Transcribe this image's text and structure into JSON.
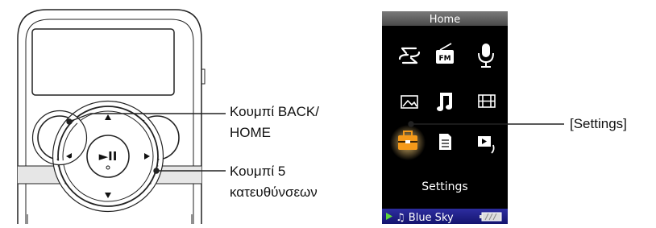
{
  "player": {
    "callouts": {
      "back_home_line1": "Κουμπί BACK/",
      "back_home_line2": "HOME",
      "five_way_line1": "Κουμπί 5",
      "five_way_line2": "κατευθύνσεων"
    },
    "buttons": {
      "play_pause_symbol": "►II"
    }
  },
  "screen": {
    "header_title": "Home",
    "fm_icon_text": "FM",
    "selected_label": "Settings",
    "now_playing": "♫ Blue Sky",
    "callout_label": "[Settings]",
    "colors": {
      "selected_icon": "#f59a1a",
      "status_bar": "#1e1e8c",
      "header_bar": "#5a5a5a",
      "play_indicator": "#5ed63a"
    },
    "icons": [
      "shuffle-icon",
      "fm-radio-icon",
      "microphone-icon",
      "photo-icon",
      "music-icon",
      "video-icon",
      "settings-toolbox-icon",
      "podcast-icon",
      "playlist-icon"
    ]
  }
}
